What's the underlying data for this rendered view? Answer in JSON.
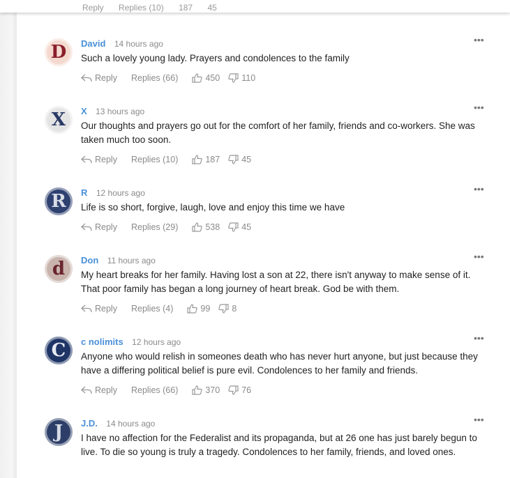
{
  "header_ghost": {
    "reply": "Reply",
    "replies": "Replies (10)",
    "up": "187",
    "down": "45"
  },
  "comments": [
    {
      "author": "David",
      "time": "14 hours ago",
      "avatar_letter": "D",
      "avatar_bg": "#f4d9cf",
      "avatar_fg": "#8a1f2b",
      "text": "Such a lovely young lady. Prayers and condolences to the family",
      "reply": "Reply",
      "replies": "Replies (66)",
      "up": "450",
      "down": "110"
    },
    {
      "author": "X",
      "time": "13 hours ago",
      "avatar_letter": "X",
      "avatar_bg": "#e4e4e4",
      "avatar_fg": "#2a3a66",
      "text": "Our thoughts and prayers go out for the comfort of her family, friends and co-workers. She was taken much too soon.",
      "reply": "Reply",
      "replies": "Replies (10)",
      "up": "187",
      "down": "45"
    },
    {
      "author": "R",
      "time": "12 hours ago",
      "avatar_letter": "R",
      "avatar_bg": "#2f4170",
      "avatar_fg": "#d8dce6",
      "text": "Life is so short, forgive, laugh, love and enjoy this time we have",
      "reply": "Reply",
      "replies": "Replies (29)",
      "up": "538",
      "down": "45"
    },
    {
      "author": "Don",
      "time": "11 hours ago",
      "avatar_letter": "d",
      "avatar_bg": "#c8b4ad",
      "avatar_fg": "#6b2530",
      "text": "My heart breaks for her family. Having lost a son at 22, there isn't anyway to make sense of it. That poor family has began a long journey of heart break. God be with them.",
      "reply": "Reply",
      "replies": "Replies (4)",
      "up": "99",
      "down": "8"
    },
    {
      "author": "c nolimits",
      "time": "12 hours ago",
      "avatar_letter": "C",
      "avatar_bg": "#1f3566",
      "avatar_fg": "#e6eaf2",
      "text": "Anyone who would relish in someones death who has never hurt anyone, but just because they have a differing political belief is pure evil. Condolences to her family and friends.",
      "reply": "Reply",
      "replies": "Replies (66)",
      "up": "370",
      "down": "76"
    },
    {
      "author": "J.D.",
      "time": "14 hours ago",
      "avatar_letter": "J",
      "avatar_bg": "#2d3f68",
      "avatar_fg": "#d6dbe6",
      "text": "I have no affection for the Federalist and its propaganda, but at 26 one has just barely begun to live. To die so young is truly a tragedy. Condolences to her family, friends, and loved ones.",
      "reply": "",
      "replies": "",
      "up": "",
      "down": ""
    }
  ]
}
